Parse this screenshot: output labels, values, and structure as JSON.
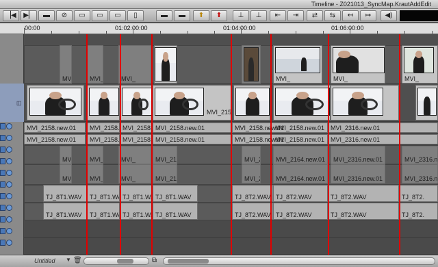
{
  "window": {
    "title": "Timeline - Z021013_SyncMap.KrautAddEdit"
  },
  "toolbar": {
    "buttons": [
      "mark-in",
      "mark-out",
      "clear-marks",
      "splice",
      "overwrite",
      "lift",
      "extract",
      "segment-mode-yellow",
      "segment-mode-red",
      "trim",
      "add-edit",
      "step-back",
      "step-forward",
      "match-frame",
      "audio",
      "nav"
    ]
  },
  "ruler": {
    "timecodes": [
      "00:00",
      "01:02:00:00",
      "01:04:00:00",
      "01:06:00:00"
    ]
  },
  "tracks": {
    "v2": {
      "clips": [
        "MVI_",
        "MVI_",
        "MVI_",
        "MVI_",
        "MVI_",
        "MVI_",
        "MVI_"
      ]
    },
    "v1": {
      "clips": [
        "MVI_2158.new.01",
        "MVI_2158.new.01"
      ]
    },
    "a1": {
      "clips": [
        "MVI_2158.new.01",
        "MVI_2158.new.01",
        "MVI_2158.new.01",
        "MVI_2158.new.01",
        "MVI_2158.new.01",
        "MVI_2158.new.01",
        "MVI_2316.new.01"
      ]
    },
    "a2": {
      "clips": [
        "MVI_2158.new.01",
        "MVI_2158.new.01",
        "MVI_2158.new.01",
        "MVI_2158.new.01",
        "MVI_2158.new.01",
        "MVI_2158.new.01",
        "MVI_2316.new.01"
      ]
    },
    "a3": {
      "clips": [
        "MVI_",
        "MVI_",
        "MVI_",
        "MVI_216",
        "MVI_2",
        "MVI_2164.new.01",
        "MVI_2316.new.01",
        "MVI_2316.new."
      ]
    },
    "a4": {
      "clips": [
        "MVI_",
        "MVI_",
        "MVI_",
        "MVI_216",
        "MVI_2",
        "MVI_2164.new.01",
        "MVI_2316.new.01",
        "MVI_2316.new."
      ]
    },
    "a5": {
      "clips": [
        "TJ_8T1.WAV",
        "TJ_8T1.WA",
        "TJ_8T1.WA",
        "TJ_8T1.WAV",
        "TJ_8T2.WAV",
        "TJ_8T2.WAV",
        "TJ_8T2.WAV",
        "TJ_8T2."
      ]
    },
    "a6": {
      "clips": [
        "TJ_8T1.WAV",
        "TJ_8T1.WA",
        "TJ_8T1.WA",
        "TJ_8T1.WAV",
        "TJ_8T2.WAV",
        "TJ_8T2.WAV",
        "TJ_8T2.WAV",
        "TJ_8T2."
      ]
    },
    "v1_tail_label": "MVI_2158"
  },
  "bottombar": {
    "sequence_name": "Untitled"
  },
  "colors": {
    "edit_marker": "#e00000",
    "track_selected": "#4a78b8"
  }
}
